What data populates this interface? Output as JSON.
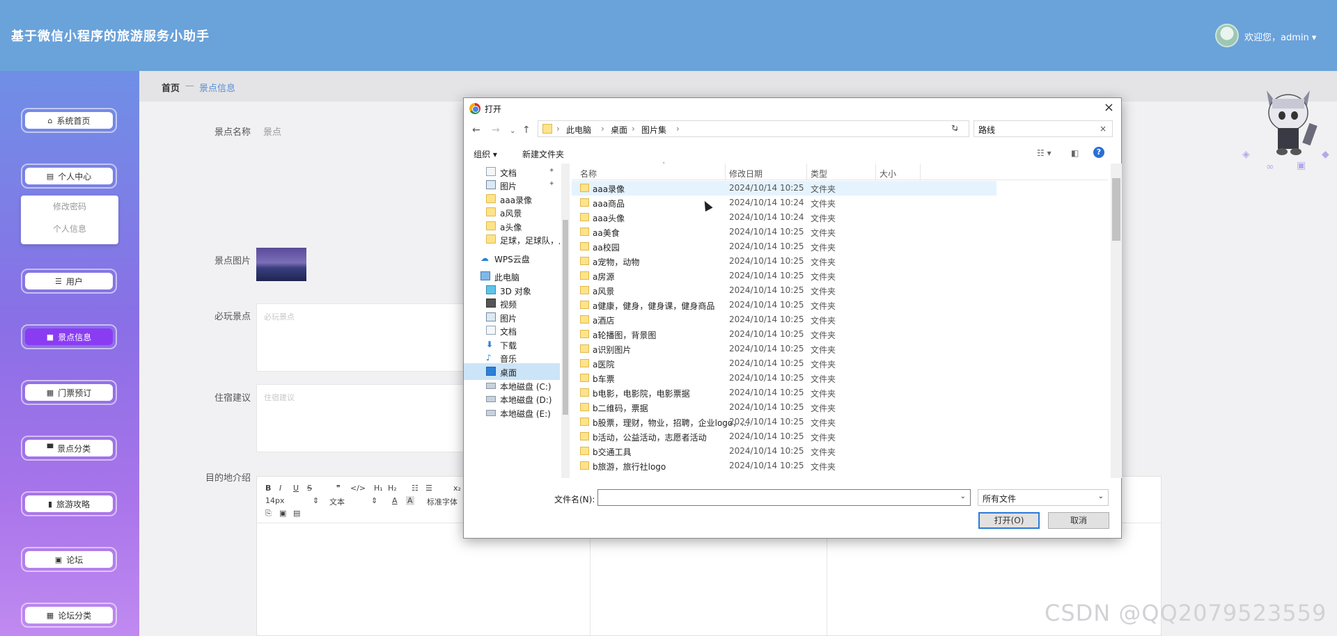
{
  "app": {
    "title": "基于微信小程序的旅游服务小助手",
    "welcome": "欢迎您，admin",
    "caret": "▾"
  },
  "sidebar": {
    "items": [
      {
        "label": "系统首页",
        "icon": "⌂"
      },
      {
        "label": "个人中心",
        "icon": "▤"
      },
      {
        "label": "用户",
        "icon": "☰"
      },
      {
        "label": "景点信息",
        "icon": "■"
      },
      {
        "label": "门票预订",
        "icon": "▦"
      },
      {
        "label": "景点分类",
        "icon": "▀"
      },
      {
        "label": "旅游攻略",
        "icon": "▮"
      },
      {
        "label": "论坛",
        "icon": "▣"
      },
      {
        "label": "论坛分类",
        "icon": "▦"
      }
    ],
    "submenu": [
      "修改密码",
      "个人信息"
    ],
    "active_color": "#8a3cf2"
  },
  "breadcrumb": {
    "home": "首页",
    "sep": "—",
    "current": "景点信息"
  },
  "form": {
    "name_label": "景点名称",
    "name_value": "景点",
    "image_label": "景点图片",
    "must_label": "必玩景点",
    "must_placeholder": "必玩景点",
    "stay_label": "住宿建议",
    "stay_placeholder": "住宿建议",
    "intro_label": "目的地介绍"
  },
  "editor": {
    "row1": [
      "B",
      "I",
      "U",
      "S",
      "❞",
      "</>",
      "H₁",
      "H₂",
      "☷",
      "☰",
      "x₂"
    ],
    "size": "14px",
    "style": "文本",
    "font": "标准字体",
    "row3": [
      "⎘",
      "▣",
      "▤"
    ]
  },
  "dialog": {
    "title": "打开",
    "close": "×",
    "nav": {
      "back": "←",
      "forward": "→",
      "recent": "⌄",
      "up": "↑"
    },
    "path": [
      "此电脑",
      "桌面",
      "图片集"
    ],
    "path_sep": "›",
    "search_value": "路线",
    "toolbar": {
      "organize": "组织 ▾",
      "new_folder": "新建文件夹",
      "help": "?"
    },
    "nav_pane": [
      {
        "label": "文档",
        "icon": "doc",
        "pin": true
      },
      {
        "label": "图片",
        "icon": "pic",
        "pin": true
      },
      {
        "label": "aaa录像",
        "icon": "fold"
      },
      {
        "label": "a风景",
        "icon": "fold"
      },
      {
        "label": "a头像",
        "icon": "fold"
      },
      {
        "label": "足球，足球队，足",
        "icon": "fold"
      },
      {
        "label": "WPS云盘",
        "icon": "cloud"
      },
      {
        "label": "此电脑",
        "icon": "pc"
      },
      {
        "label": "3D 对象",
        "icon": "cube"
      },
      {
        "label": "视频",
        "icon": "video"
      },
      {
        "label": "图片",
        "icon": "pic"
      },
      {
        "label": "文档",
        "icon": "doc"
      },
      {
        "label": "下载",
        "icon": "down"
      },
      {
        "label": "音乐",
        "icon": "music"
      },
      {
        "label": "桌面",
        "icon": "blue",
        "selected": true
      },
      {
        "label": "本地磁盘 (C:)",
        "icon": "drive"
      },
      {
        "label": "本地磁盘 (D:)",
        "icon": "drive"
      },
      {
        "label": "本地磁盘 (E:)",
        "icon": "drive"
      }
    ],
    "columns": {
      "name": "名称",
      "date": "修改日期",
      "type": "类型",
      "size": "大小"
    },
    "files": [
      {
        "name": "aaa录像",
        "date": "2024/10/14 10:25",
        "type": "文件夹"
      },
      {
        "name": "aaa商品",
        "date": "2024/10/14 10:24",
        "type": "文件夹"
      },
      {
        "name": "aaa头像",
        "date": "2024/10/14 10:24",
        "type": "文件夹"
      },
      {
        "name": "aa美食",
        "date": "2024/10/14 10:25",
        "type": "文件夹"
      },
      {
        "name": "aa校园",
        "date": "2024/10/14 10:25",
        "type": "文件夹"
      },
      {
        "name": "a宠物，动物",
        "date": "2024/10/14 10:25",
        "type": "文件夹"
      },
      {
        "name": "a房源",
        "date": "2024/10/14 10:25",
        "type": "文件夹"
      },
      {
        "name": "a风景",
        "date": "2024/10/14 10:25",
        "type": "文件夹"
      },
      {
        "name": "a健康，健身，健身课，健身商品",
        "date": "2024/10/14 10:25",
        "type": "文件夹"
      },
      {
        "name": "a酒店",
        "date": "2024/10/14 10:25",
        "type": "文件夹"
      },
      {
        "name": "a轮播图，背景图",
        "date": "2024/10/14 10:25",
        "type": "文件夹"
      },
      {
        "name": "a识别图片",
        "date": "2024/10/14 10:25",
        "type": "文件夹"
      },
      {
        "name": "a医院",
        "date": "2024/10/14 10:25",
        "type": "文件夹"
      },
      {
        "name": "b车票",
        "date": "2024/10/14 10:25",
        "type": "文件夹"
      },
      {
        "name": "b电影，电影院，电影票据",
        "date": "2024/10/14 10:25",
        "type": "文件夹"
      },
      {
        "name": "b二维码，票据",
        "date": "2024/10/14 10:25",
        "type": "文件夹"
      },
      {
        "name": "b股票，理财，物业，招聘，企业logo，...",
        "date": "2024/10/14 10:25",
        "type": "文件夹"
      },
      {
        "name": "b活动，公益活动，志愿者活动",
        "date": "2024/10/14 10:25",
        "type": "文件夹"
      },
      {
        "name": "b交通工具",
        "date": "2024/10/14 10:25",
        "type": "文件夹"
      },
      {
        "name": "b旅游，旅行社logo",
        "date": "2024/10/14 10:25",
        "type": "文件夹"
      }
    ],
    "filename_label": "文件名(N):",
    "filename_value": "",
    "filetype": "所有文件",
    "open_button": "打开(O)",
    "cancel_button": "取消"
  },
  "watermark": "CSDN @QQ2079523559"
}
